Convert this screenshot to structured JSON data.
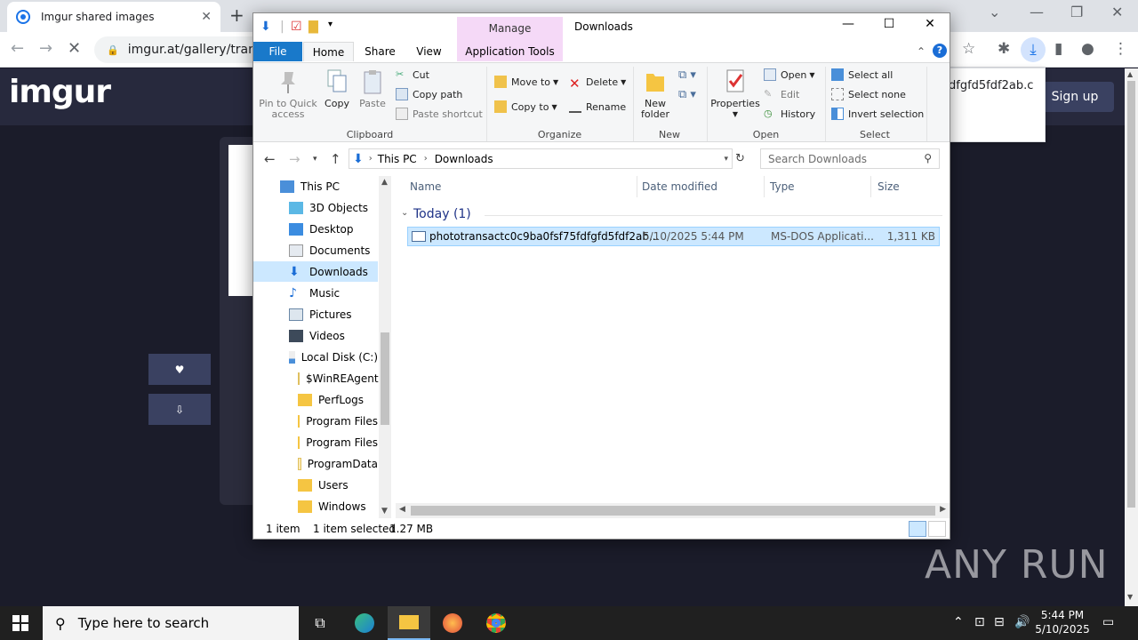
{
  "browser": {
    "tab_title": "Imgur shared images",
    "tab_close": "✕",
    "new_tab": "+",
    "url": "imgur.at/gallery/transa",
    "download_popup_text": "dfgfd5fdf2ab.c"
  },
  "imgur": {
    "logo": "imgur",
    "signup_label": "Sign up",
    "like_button": "♥",
    "download_button": "⇩"
  },
  "explorer": {
    "title": "Downloads",
    "manage_label": "Manage",
    "ribbon_tabs": [
      "File",
      "Home",
      "Share",
      "View",
      "Application Tools"
    ],
    "clipboard": {
      "pin": "Pin to Quick access",
      "copy": "Copy",
      "paste": "Paste",
      "cut": "Cut",
      "copy_path": "Copy path",
      "paste_shortcut": "Paste shortcut",
      "group": "Clipboard"
    },
    "organize": {
      "move_to": "Move to",
      "copy_to": "Copy to",
      "delete": "Delete",
      "rename": "Rename",
      "group": "Organize"
    },
    "new": {
      "new_folder": "New folder",
      "group": "New"
    },
    "open": {
      "properties": "Properties",
      "open": "Open",
      "edit": "Edit",
      "history": "History",
      "group": "Open"
    },
    "select": {
      "select_all": "Select all",
      "select_none": "Select none",
      "invert": "Invert selection",
      "group": "Select"
    },
    "address": {
      "crumb1": "This PC",
      "crumb2": "Downloads"
    },
    "search_placeholder": "Search Downloads",
    "nav": [
      "This PC",
      "3D Objects",
      "Desktop",
      "Documents",
      "Downloads",
      "Music",
      "Pictures",
      "Videos",
      "Local Disk (C:)",
      "$WinREAgent",
      "PerfLogs",
      "Program Files",
      "Program Files",
      "ProgramData",
      "Users",
      "Windows"
    ],
    "columns": {
      "name": "Name",
      "date": "Date modified",
      "type": "Type",
      "size": "Size"
    },
    "group_header": "Today (1)",
    "file": {
      "name": "phototransactc0c9ba0fsf75fdfgfd5fdf2ab...",
      "date": "5/10/2025 5:44 PM",
      "type": "MS-DOS Applicati...",
      "size": "1,311 KB"
    },
    "status": {
      "count": "1 item",
      "selected": "1 item selected",
      "size": "1.27 MB"
    }
  },
  "taskbar": {
    "search_placeholder": "Type here to search",
    "time": "5:44 PM",
    "date": "5/10/2025"
  },
  "watermark": "ANY RUN"
}
